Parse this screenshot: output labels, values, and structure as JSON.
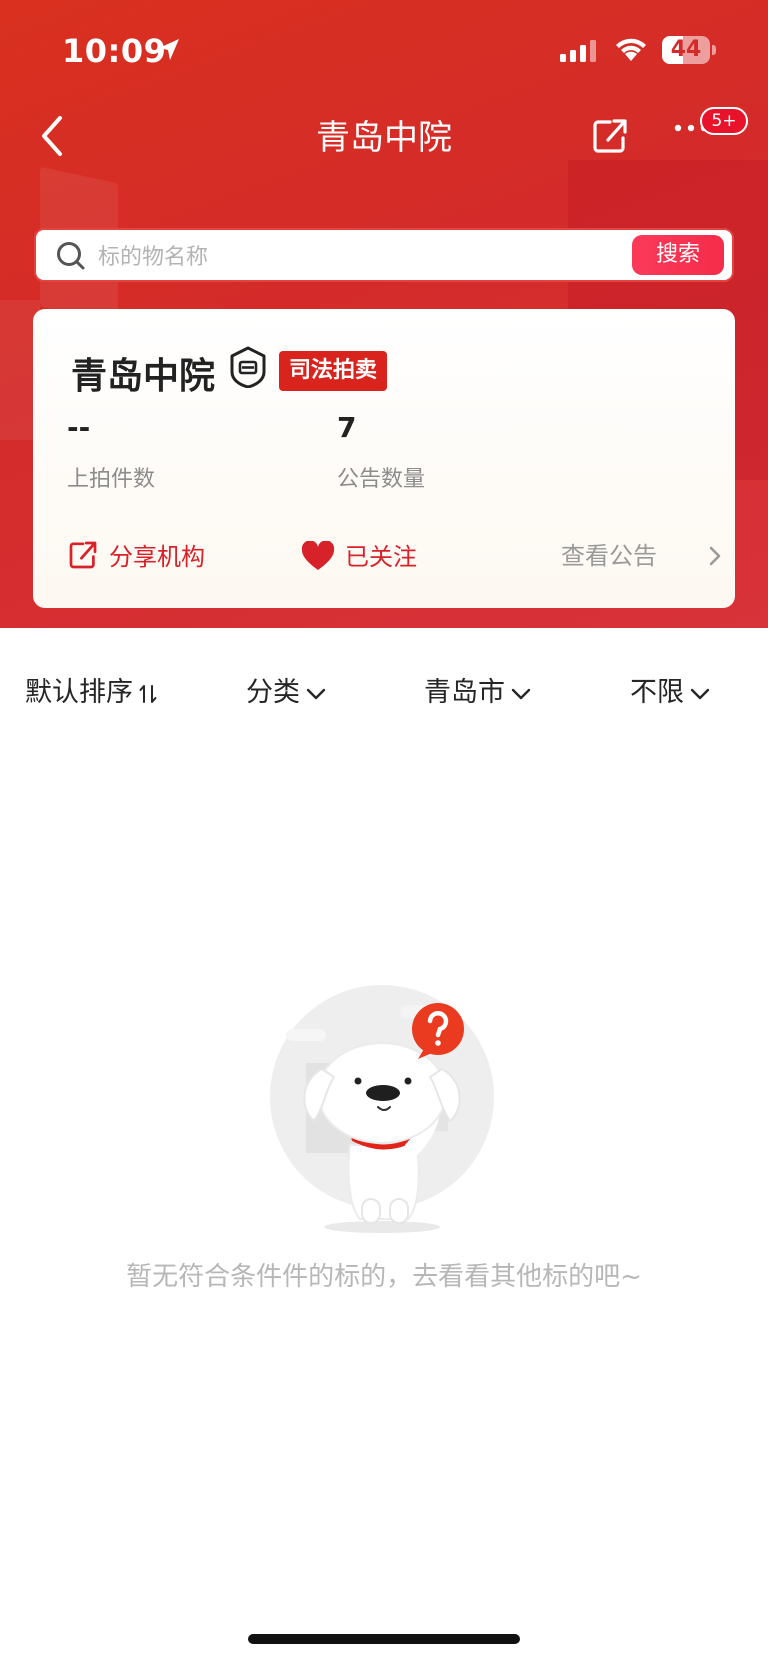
{
  "status_bar": {
    "time": "10:09",
    "battery": "44",
    "battery_level": 0.44
  },
  "nav": {
    "title": "青岛中院",
    "more_badge": "5+"
  },
  "search": {
    "placeholder": "标的物名称",
    "button": "搜索"
  },
  "org": {
    "name": "青岛中院",
    "tag": "司法拍卖",
    "stats": [
      {
        "value": "--",
        "label": "上拍件数"
      },
      {
        "value": "7",
        "label": "公告数量"
      }
    ],
    "actions": {
      "share": "分享机构",
      "follow": "已关注",
      "view_notice": "查看公告"
    }
  },
  "filters": [
    {
      "label": "默认排序"
    },
    {
      "label": "分类"
    },
    {
      "label": "青岛市"
    },
    {
      "label": "不限"
    }
  ],
  "empty_state": {
    "message": "暂无符合条件件的标的，去看看其他标的吧~"
  },
  "colors": {
    "brand_red": "#d42b2a",
    "accent_red": "#d8222a",
    "search_btn": "#f52c4a"
  }
}
